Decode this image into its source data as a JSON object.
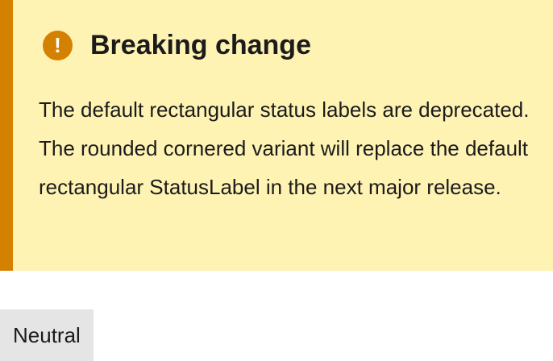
{
  "callout": {
    "icon": "exclamation-icon",
    "title": "Breaking change",
    "body": "The default rectangular status labels are deprecated. The rounded cornered variant will replace the default rectangular StatusLabel in the next major release."
  },
  "status_label": {
    "text": "Neutral"
  },
  "colors": {
    "callout_background": "#fff3b4",
    "callout_accent": "#d48000",
    "status_label_background": "#e5e5e5",
    "text": "#1b1b1b"
  }
}
